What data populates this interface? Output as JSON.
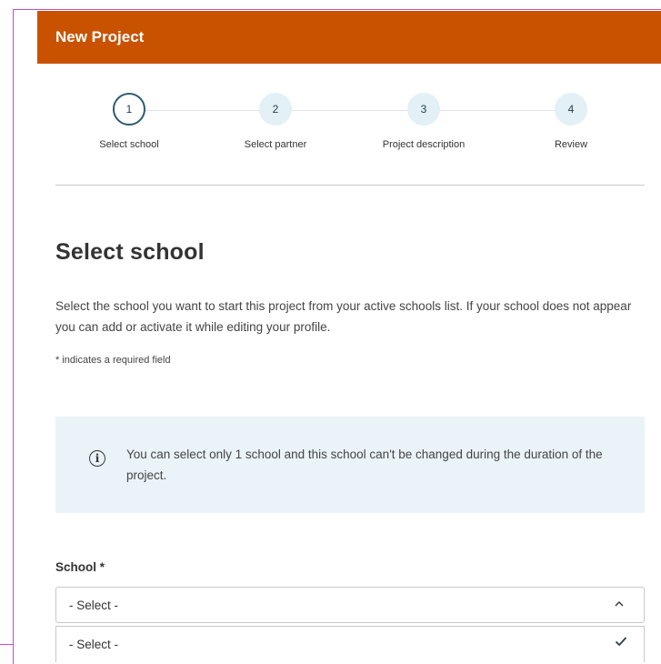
{
  "header": {
    "title": "New Project"
  },
  "stepper": {
    "steps": [
      {
        "number": "1",
        "label": "Select school",
        "active": true
      },
      {
        "number": "2",
        "label": "Select partner",
        "active": false
      },
      {
        "number": "3",
        "label": "Project description",
        "active": false
      },
      {
        "number": "4",
        "label": "Review",
        "active": false
      }
    ]
  },
  "main": {
    "title": "Select school",
    "intro": "Select the school you want to start this project from your active schools list. If your school does not appear you can add or activate it while editing your profile.",
    "required_note": "* indicates a required field",
    "info": {
      "icon": "info-icon",
      "text": "You can select only 1 school and this school can't be changed during the duration of the project."
    },
    "school_field": {
      "label": "School *",
      "selected_value": "- Select -",
      "chevron_icon": "chevron-up-icon",
      "options": [
        {
          "label": "- Select -",
          "selected": true
        }
      ]
    }
  },
  "colors": {
    "header_bg": "#c95200",
    "info_bg": "#eaf3f8",
    "step_bg": "#e3f0f6",
    "frame": "#c84bd3"
  }
}
